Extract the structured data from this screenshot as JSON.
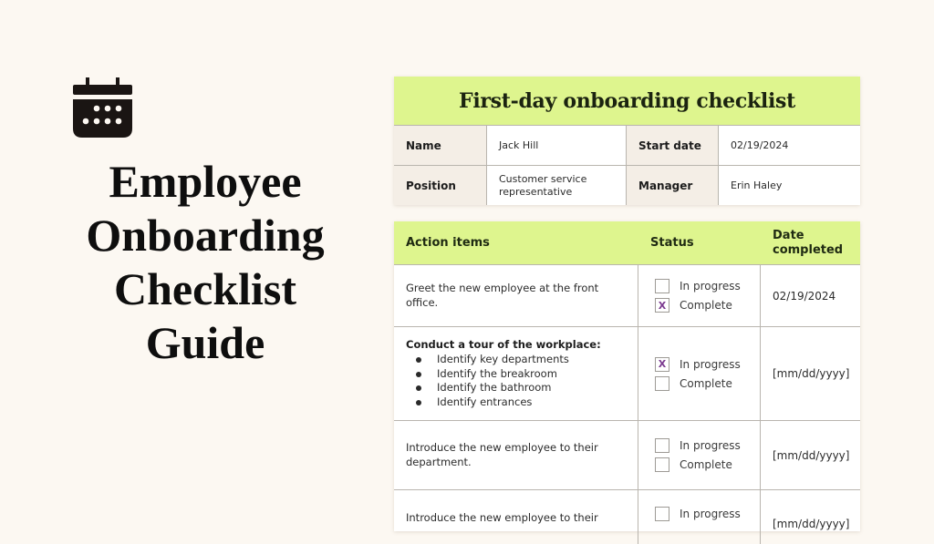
{
  "hero": {
    "icon": "calendar-icon",
    "title_lines": [
      "Employee",
      "Onboarding",
      "Checklist",
      "Guide"
    ]
  },
  "colors": {
    "background": "#fcf8f2",
    "header_green": "#def58e",
    "label_beige": "#f4eee6",
    "check_mark": "#7b3a8f"
  },
  "info_card": {
    "title": "First-day onboarding checklist",
    "rows": [
      {
        "label1": "Name",
        "value1": "Jack Hill",
        "label2": "Start date",
        "value2": "02/19/2024"
      },
      {
        "label1": "Position",
        "value1": "Customer service representative",
        "label2": "Manager",
        "value2": "Erin Haley"
      }
    ]
  },
  "tasks": {
    "headers": {
      "action": "Action items",
      "status": "Status",
      "date": "Date completed"
    },
    "status_options": {
      "in_progress": "In progress",
      "complete": "Complete"
    },
    "check_symbol": "X",
    "rows": [
      {
        "action": "Greet the new employee at the front office.",
        "in_progress_checked": "",
        "complete_checked": "X",
        "date": "02/19/2024"
      },
      {
        "action_title": "Conduct a tour of the workplace:",
        "subitems": [
          "Identify key departments",
          "Identify the breakroom",
          "Identify the bathroom",
          "Identify entrances"
        ],
        "in_progress_checked": "X",
        "complete_checked": "",
        "date": "[mm/dd/yyyy]"
      },
      {
        "action": "Introduce the new employee to their department.",
        "in_progress_checked": "",
        "complete_checked": "",
        "date": "[mm/dd/yyyy]"
      },
      {
        "action": "Introduce the new employee to their",
        "in_progress_checked": "",
        "complete_checked": "",
        "date": "[mm/dd/yyyy]"
      }
    ]
  }
}
